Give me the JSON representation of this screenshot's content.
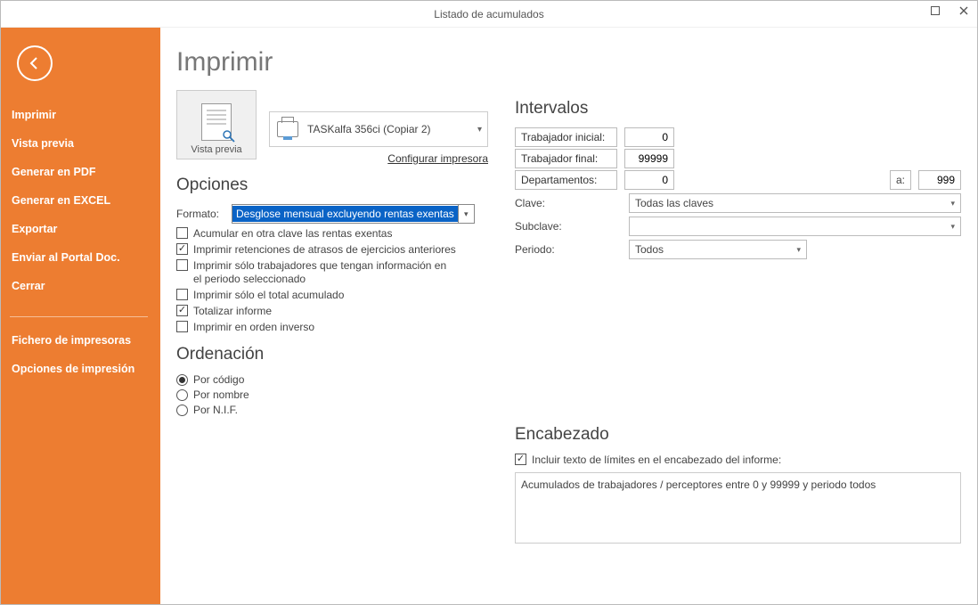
{
  "window": {
    "title": "Listado de acumulados"
  },
  "sidebar": {
    "items": [
      "Imprimir",
      "Vista previa",
      "Generar en PDF",
      "Generar en EXCEL",
      "Exportar",
      "Enviar al Portal Doc.",
      "Cerrar"
    ],
    "items2": [
      "Fichero de impresoras",
      "Opciones de impresión"
    ]
  },
  "page": {
    "title": "Imprimir",
    "preview_label": "Vista previa",
    "printer_name": "TASKalfa 356ci (Copiar 2)",
    "config_link": "Configurar impresora"
  },
  "opciones": {
    "heading": "Opciones",
    "formato_label": "Formato:",
    "formato_value": "Desglose mensual excluyendo rentas exentas",
    "checks": {
      "c1": {
        "label": "Acumular en otra clave las rentas exentas",
        "checked": false
      },
      "c2": {
        "label": "Imprimir retenciones de atrasos de ejercicios anteriores",
        "checked": true
      },
      "c3": {
        "label": "Imprimir sólo trabajadores que tengan información en el periodo seleccionado",
        "checked": false
      },
      "c4": {
        "label": "Imprimir sólo el total acumulado",
        "checked": false
      },
      "c5": {
        "label": "Totalizar informe",
        "checked": true
      },
      "c6": {
        "label": "Imprimir en orden inverso",
        "checked": false
      }
    }
  },
  "ordenacion": {
    "heading": "Ordenación",
    "options": {
      "r1": "Por código",
      "r2": "Por nombre",
      "r3": "Por N.I.F."
    },
    "selected": "r1"
  },
  "intervalos": {
    "heading": "Intervalos",
    "trabajador_inicial_label": "Trabajador inicial:",
    "trabajador_inicial": "0",
    "trabajador_final_label": "Trabajador final:",
    "trabajador_final": "99999",
    "departamentos_label": "Departamentos:",
    "departamentos_from": "0",
    "a_label": "a:",
    "departamentos_to": "999",
    "clave_label": "Clave:",
    "clave_value": "Todas las claves",
    "subclave_label": "Subclave:",
    "subclave_value": "",
    "periodo_label": "Periodo:",
    "periodo_value": "Todos"
  },
  "encabezado": {
    "heading": "Encabezado",
    "check_label": "Incluir texto de límites en el encabezado del informe:",
    "check_checked": true,
    "text": "Acumulados de trabajadores / perceptores entre 0 y 99999 y periodo todos"
  }
}
